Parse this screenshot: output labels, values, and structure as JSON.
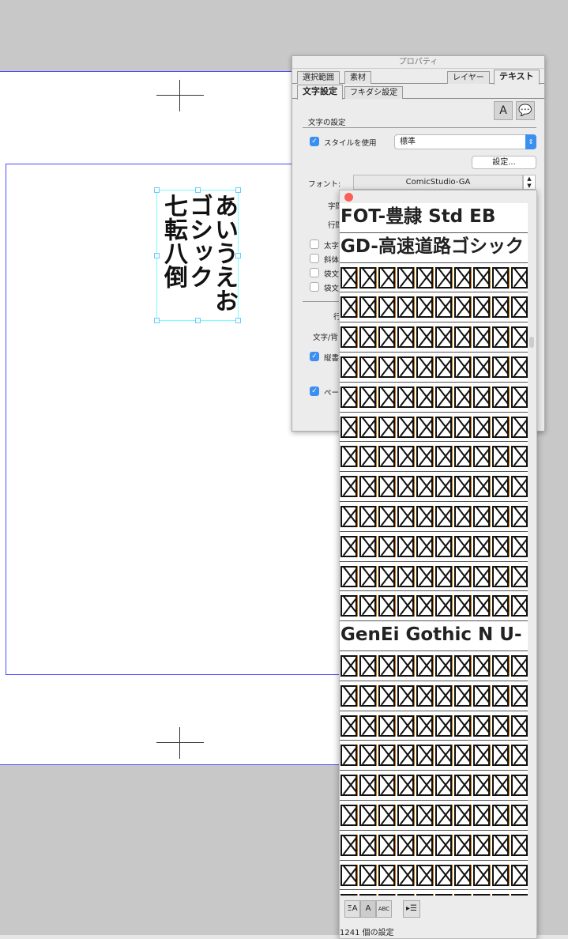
{
  "canvas": {
    "columns": [
      "あいうえお",
      "ゴシック",
      "七転八倒"
    ]
  },
  "panel": {
    "title": "プロパティ",
    "tabs": [
      "選択範囲",
      "素材",
      "レイヤー",
      "テキスト"
    ],
    "subtabs": [
      "文字設定",
      "フキダシ設定"
    ],
    "section": "文字の設定",
    "use_style_label": "スタイルを使用",
    "style_value": "標準",
    "settings_button": "設定...",
    "font_label": "フォント:",
    "font_value": "ComicStudio-GA",
    "labels": [
      "字間",
      "行間",
      "太字",
      "斜体",
      "袋文",
      "袋文",
      "行",
      "文字/背",
      "縦書",
      "ペー"
    ]
  },
  "font_list": {
    "items": [
      {
        "type": "name",
        "label": "FOT-豊隷 Std EB"
      },
      {
        "type": "name",
        "label": "GD-高速道路ゴシック"
      },
      {
        "type": "missing"
      },
      {
        "type": "missing"
      },
      {
        "type": "missing"
      },
      {
        "type": "missing"
      },
      {
        "type": "missing"
      },
      {
        "type": "missing"
      },
      {
        "type": "missing"
      },
      {
        "type": "missing"
      },
      {
        "type": "missing"
      },
      {
        "type": "missing"
      },
      {
        "type": "missing"
      },
      {
        "type": "missing"
      },
      {
        "type": "name",
        "label": "GenEi Gothic N U-"
      },
      {
        "type": "missing"
      },
      {
        "type": "missing"
      },
      {
        "type": "missing"
      },
      {
        "type": "missing"
      },
      {
        "type": "missing"
      },
      {
        "type": "missing"
      },
      {
        "type": "missing"
      },
      {
        "type": "missing"
      },
      {
        "type": "missing"
      }
    ],
    "count_label": "1241 個の設定",
    "toolbar": [
      "ΞA",
      "A",
      "ABC",
      "▸☰"
    ]
  }
}
